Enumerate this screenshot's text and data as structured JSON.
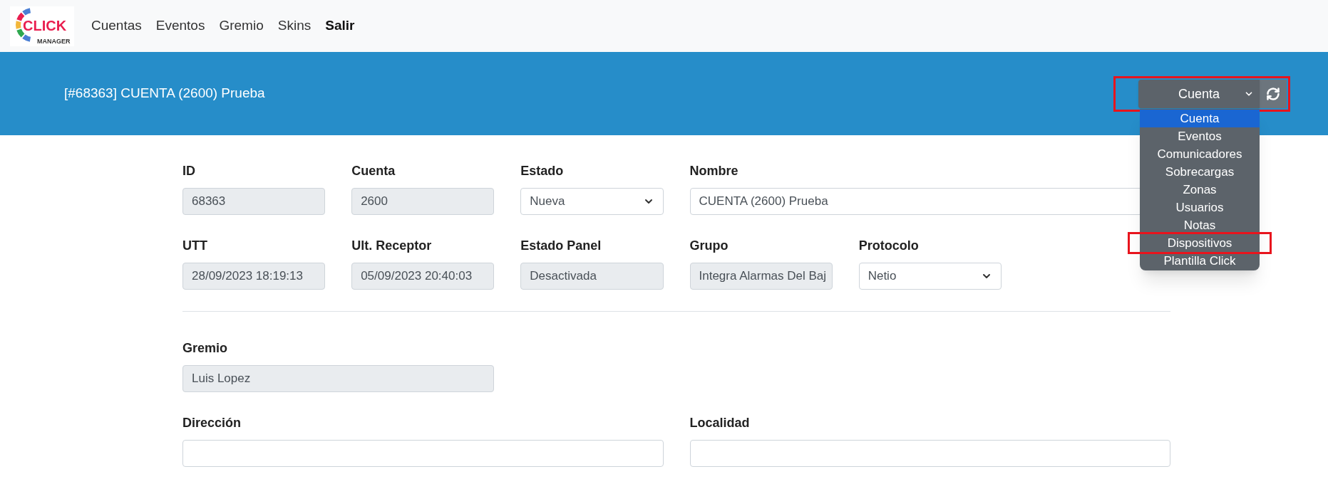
{
  "navbar": {
    "logo": {
      "word": "CLICK",
      "subword": "MANAGER"
    },
    "links": [
      {
        "label": "Cuentas",
        "kind": "link"
      },
      {
        "label": "Eventos",
        "kind": "link"
      },
      {
        "label": "Gremio",
        "kind": "link"
      },
      {
        "label": "Skins",
        "kind": "link"
      },
      {
        "label": "Salir",
        "kind": "action"
      }
    ]
  },
  "header": {
    "title": "[#68363] CUENTA (2600) Prueba",
    "section_select": {
      "value": "Cuenta",
      "expanded": true,
      "highlighted": true,
      "options": [
        {
          "label": "Cuenta",
          "selected": true,
          "highlighted": false
        },
        {
          "label": "Eventos",
          "selected": false,
          "highlighted": false
        },
        {
          "label": "Comunicadores",
          "selected": false,
          "highlighted": false
        },
        {
          "label": "Sobrecargas",
          "selected": false,
          "highlighted": false
        },
        {
          "label": "Zonas",
          "selected": false,
          "highlighted": false
        },
        {
          "label": "Usuarios",
          "selected": false,
          "highlighted": false
        },
        {
          "label": "Notas",
          "selected": false,
          "highlighted": false
        },
        {
          "label": "Dispositivos",
          "selected": false,
          "highlighted": true
        },
        {
          "label": "Plantilla Click",
          "selected": false,
          "highlighted": false
        }
      ]
    }
  },
  "form": {
    "rows": [
      {
        "fields": [
          {
            "label": "ID",
            "value": "68363",
            "kind": "readonly"
          },
          {
            "label": "Cuenta",
            "value": "2600",
            "kind": "readonly"
          },
          {
            "label": "Estado",
            "value": "Nueva",
            "kind": "select"
          },
          {
            "label": "Nombre",
            "value": "CUENTA (2600) Prueba",
            "kind": "input"
          }
        ]
      },
      {
        "fields": [
          {
            "label": "UTT",
            "value": "28/09/2023 18:19:13",
            "kind": "readonly"
          },
          {
            "label": "Ult. Receptor",
            "value": "05/09/2023 20:40:03",
            "kind": "readonly"
          },
          {
            "label": "Estado Panel",
            "value": "Desactivada",
            "kind": "readonly"
          },
          {
            "label": "Grupo",
            "value": "Integra Alarmas Del Baj",
            "kind": "readonly"
          },
          {
            "label": "Protocolo",
            "value": "Netio",
            "kind": "select"
          }
        ],
        "divider_after": true
      },
      {
        "fields": [
          {
            "label": "Gremio",
            "value": "Luis Lopez",
            "kind": "readonly"
          }
        ]
      },
      {
        "fields": [
          {
            "label": "Dirección",
            "kind": "input"
          },
          {
            "label": "Localidad",
            "kind": "input"
          }
        ]
      }
    ]
  }
}
